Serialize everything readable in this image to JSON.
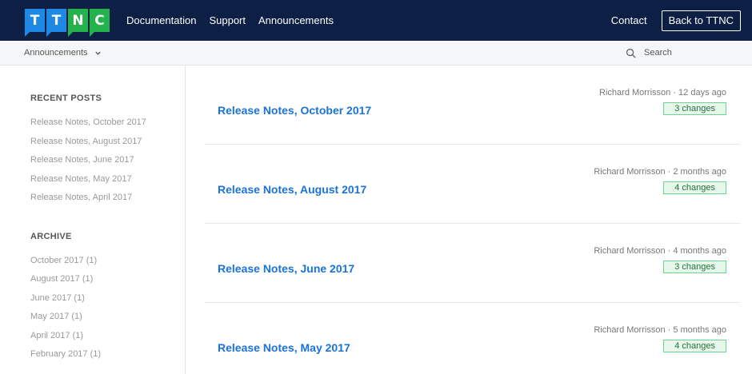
{
  "logo": [
    "T",
    "T",
    "N",
    "C"
  ],
  "nav": {
    "documentation": "Documentation",
    "support": "Support",
    "announcements": "Announcements",
    "contact": "Contact",
    "back": "Back to TTNC"
  },
  "subbar": {
    "breadcrumb": "Announcements",
    "search_placeholder": "Search"
  },
  "sidebar": {
    "recent_heading": "RECENT POSTS",
    "recent": [
      "Release Notes, October 2017",
      "Release Notes, August 2017",
      "Release Notes, June 2017",
      "Release Notes, May 2017",
      "Release Notes, April 2017"
    ],
    "archive_heading": "ARCHIVE",
    "archive": [
      "October 2017 (1)",
      "August 2017 (1)",
      "June 2017 (1)",
      "May 2017 (1)",
      "April 2017 (1)",
      "February 2017 (1)"
    ]
  },
  "posts": [
    {
      "title": "Release Notes, October 2017",
      "meta": "Richard Morrisson · 12 days ago",
      "changes": "3 changes"
    },
    {
      "title": "Release Notes, August 2017",
      "meta": "Richard Morrisson · 2 months ago",
      "changes": "4 changes"
    },
    {
      "title": "Release Notes, June 2017",
      "meta": "Richard Morrisson · 4 months ago",
      "changes": "3 changes"
    },
    {
      "title": "Release Notes, May 2017",
      "meta": "Richard Morrisson · 5 months ago",
      "changes": "4 changes"
    }
  ],
  "colors": {
    "header_bg": "#0d1f44",
    "logo_blue": "#1e88e5",
    "logo_green": "#23b24b",
    "link": "#1a73d9",
    "badge_bg": "#e6f7ec"
  }
}
